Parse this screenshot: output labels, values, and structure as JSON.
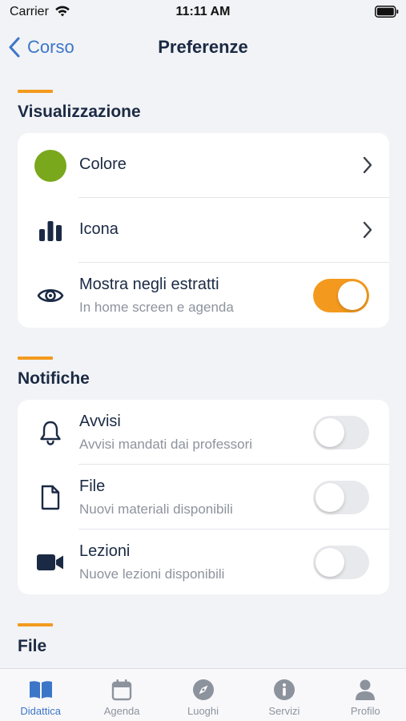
{
  "status_bar": {
    "carrier": "Carrier",
    "time": "11:11 AM"
  },
  "nav": {
    "back_label": "Corso",
    "title": "Preferenze"
  },
  "colors": {
    "accent": "#f39a1e",
    "link": "#3c76c8",
    "dot": "#7aa81c",
    "navy": "#1b2a44"
  },
  "sections": [
    {
      "title": "Visualizzazione",
      "rows": [
        {
          "label": "Colore",
          "icon": "color-dot-icon",
          "control": "chevron"
        },
        {
          "label": "Icona",
          "icon": "bar-chart-icon",
          "control": "chevron"
        },
        {
          "label": "Mostra negli estratti",
          "sublabel": "In home screen e agenda",
          "icon": "eye-icon",
          "control": "toggle",
          "on": true
        }
      ]
    },
    {
      "title": "Notifiche",
      "rows": [
        {
          "label": "Avvisi",
          "sublabel": "Avvisi mandati dai professori",
          "icon": "bell-icon",
          "control": "toggle",
          "on": false
        },
        {
          "label": "File",
          "sublabel": "Nuovi materiali disponibili",
          "icon": "file-icon",
          "control": "toggle",
          "on": false
        },
        {
          "label": "Lezioni",
          "sublabel": "Nuove lezioni disponibili",
          "icon": "video-camera-icon",
          "control": "toggle",
          "on": false
        }
      ]
    },
    {
      "title": "File"
    }
  ],
  "tabs": [
    {
      "label": "Didattica",
      "icon": "book-icon",
      "active": true
    },
    {
      "label": "Agenda",
      "icon": "calendar-icon",
      "active": false
    },
    {
      "label": "Luoghi",
      "icon": "compass-icon",
      "active": false
    },
    {
      "label": "Servizi",
      "icon": "info-icon",
      "active": false
    },
    {
      "label": "Profilo",
      "icon": "user-icon",
      "active": false
    }
  ]
}
